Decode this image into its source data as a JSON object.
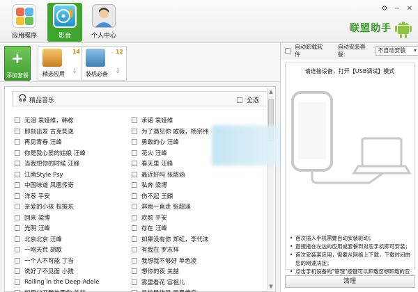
{
  "nav": [
    {
      "label": "应用程序",
      "icon": "apps-icon"
    },
    {
      "label": "影音",
      "icon": "media-icon"
    },
    {
      "label": "个人中心",
      "icon": "user-icon"
    }
  ],
  "brand": {
    "text": "联盟助手",
    "icon": "android-robot-icon"
  },
  "window_controls": [
    "gear-icon",
    "minimize-icon",
    "close-icon"
  ],
  "toolbar": {
    "add_label": "添加套餐",
    "packs": [
      {
        "label": "精选应用",
        "count": "14"
      },
      {
        "label": "装机必备",
        "count": "12"
      }
    ]
  },
  "section": {
    "title": "精品音乐",
    "select_all": "全选"
  },
  "songs_left": [
    "无泪 袁娅维，韩栋",
    "即刻出发 古克隽逸",
    "再见青春 汪峰",
    "你是我心爱的姑娘 汪峰",
    "当我想你的时候 汪峰",
    "江南Style Psy",
    "中国味道 凤凰传奇",
    "洋葱 平安",
    "亲爱的小孩 权振东",
    "回来 梁博",
    "光明 汪峰",
    "北京北京 汪峰",
    "一吻天荒 胡歌",
    "一个人不可能 丁当",
    "说好了不见面 小贱",
    "Rolling in the Deep Adele",
    "如果分开我也要你 关喆"
  ],
  "songs_right": [
    "承诺 袁娅维",
    "为了遇见你 戚薇，杨宗纬",
    "勇敢的心 汪峰",
    "花火 汪峰",
    "春天里 汪峰",
    "最近好吗 张韶涵",
    "私奔 梁博",
    "伤不起 王麟",
    "淋雨一直走 张韶涵",
    "欢颜 平安",
    "存在 汪峰",
    "如果没有你 郑虹，李代沫",
    "有我在 罗志祥",
    "我想我不够好 单色凌",
    "想你的夜 关喆",
    "雾里看花 容祖儿",
    "最炫民族风 凤凰传奇"
  ],
  "right_panel": {
    "auto_uninstall": "自动卸载软件",
    "auto_install_label": "自动安装套餐:",
    "auto_install_value": "不自动安装",
    "hint": "请连接设备，打开【USB调试】模式",
    "steps": [
      "首次插入手机需要自动安装驱动；",
      "直接拖在左边的应用或套餐到对应手机即可安装；",
      "首次安装某应用，需要从网络上下载，下载时间由您的网速决定；",
      "点击手机设备的\"管理\"按键可以卸载您想卸载的应用。"
    ],
    "clear_label": "清理"
  }
}
